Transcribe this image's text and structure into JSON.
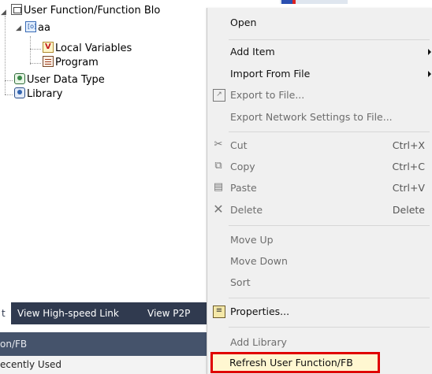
{
  "tree": {
    "root_label": "User Function/Function Blo",
    "child_label": "aa",
    "local_vars_label": "Local Variables",
    "program_label": "Program",
    "user_data_type_label": "User Data Type",
    "library_label": "Library"
  },
  "bottom_panel": {
    "tabs": [
      "t",
      "View High-speed Link",
      "View P2P"
    ],
    "subheader": "on/FB",
    "recent": "ecently Used"
  },
  "menu": {
    "open": "Open",
    "add_item": "Add Item",
    "import_from_file": "Import From File",
    "export_to_file": "Export to File...",
    "export_network": "Export Network Settings to File...",
    "cut": "Cut",
    "cut_sc": "Ctrl+X",
    "copy": "Copy",
    "copy_sc": "Ctrl+C",
    "paste": "Paste",
    "paste_sc": "Ctrl+V",
    "delete": "Delete",
    "delete_sc": "Delete",
    "move_up": "Move Up",
    "move_down": "Move Down",
    "sort": "Sort",
    "properties": "Properties...",
    "add_library": "Add Library",
    "refresh": "Refresh User Function/FB"
  },
  "icons": {
    "cut": "scissors-icon",
    "copy": "copy-icon",
    "paste": "paste-icon",
    "delete": "delete-x-icon",
    "export": "export-icon",
    "properties": "properties-icon"
  },
  "colors": {
    "highlight_border": "#e00000",
    "tabbar": "#303a4f"
  }
}
